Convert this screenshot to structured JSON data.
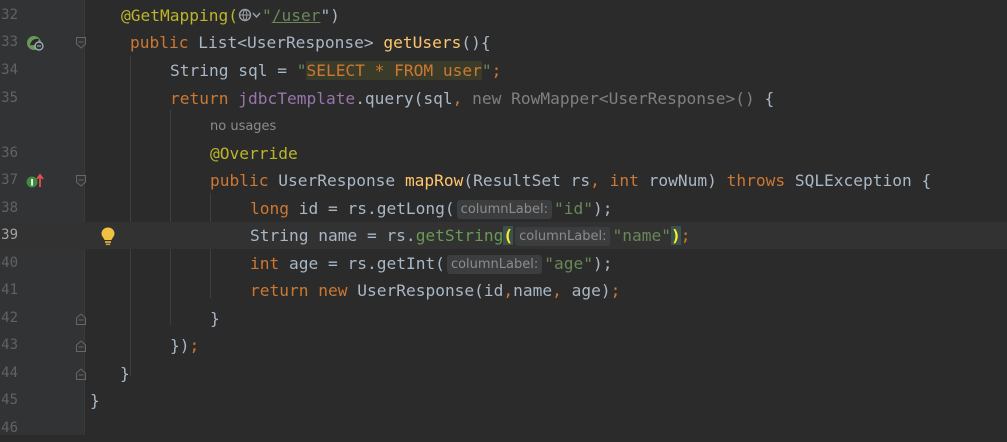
{
  "lines": [
    {
      "no": "32"
    },
    {
      "no": "33"
    },
    {
      "no": "34"
    },
    {
      "no": "35"
    },
    {
      "no": ""
    },
    {
      "no": "36"
    },
    {
      "no": "37"
    },
    {
      "no": "38"
    },
    {
      "no": "39"
    },
    {
      "no": "40"
    },
    {
      "no": "41"
    },
    {
      "no": "42"
    },
    {
      "no": "43"
    },
    {
      "no": "44"
    },
    {
      "no": "45"
    },
    {
      "no": "46"
    }
  ],
  "code": {
    "l32": {
      "annotation": "@GetMapping(",
      "quote_open": "\"",
      "url": "/user",
      "quote_close": "\")"
    },
    "l33": {
      "kw": "public",
      "type": " List<UserResponse> ",
      "fn": "getUsers",
      "rest": "(){"
    },
    "l34": {
      "p1": "String sql = ",
      "q1": "\"",
      "sql": "SELECT * FROM user",
      "q2": "\"",
      "semi": ";"
    },
    "l35": {
      "kw": "return",
      "sp": " ",
      "field": "jdbcTemplate",
      "mid": ".query(sql",
      "comma": ", ",
      "grey": "new RowMapper<UserResponse>()",
      "end": " {"
    },
    "usages": "no usages",
    "l36": {
      "annotation": "@Override"
    },
    "l37": {
      "kw": "public",
      "type": " UserResponse ",
      "fn": "mapRow",
      "p1": "(ResultSet rs",
      "comma": ", ",
      "kw2": "int",
      "p2": " rowNum) ",
      "kw3": "throws",
      "p3": " SQLException {"
    },
    "l38": {
      "kw": "long",
      "p1": " id = rs.getLong(",
      "hint": "columnLabel:",
      "str": "\"id\"",
      "end": ");"
    },
    "l39": {
      "p1": "String name = rs.",
      "fn": "getString",
      "paren": "(",
      "hint": "columnLabel:",
      "str": "\"name\"",
      "paren2": ")",
      "semi": ";"
    },
    "l40": {
      "kw": "int",
      "p1": " age = rs.getInt(",
      "hint": "columnLabel:",
      "str": "\"age\"",
      "end": ");"
    },
    "l41": {
      "kw": "return",
      "sp": " ",
      "kw2": "new",
      "p1": " UserResponse(id",
      "comma": ",",
      "p2": "name",
      "comma2": ", ",
      "p3": "age)",
      "semi": ";"
    },
    "l42": {
      "p1": "}"
    },
    "l43": {
      "p1": "})",
      "semi": ";"
    },
    "l44": {
      "p1": "}"
    },
    "l45": {
      "p1": "}"
    }
  },
  "colors": {
    "background": "#2b2b2b",
    "keyword": "#cc7832",
    "function": "#ffc66d",
    "string": "#6a8759",
    "annotation": "#bbb529"
  },
  "icons": [
    "spring-bean-icon",
    "override-marker-icon",
    "quick-fix-bulb-icon",
    "globe-icon",
    "fold-marker-icon"
  ]
}
